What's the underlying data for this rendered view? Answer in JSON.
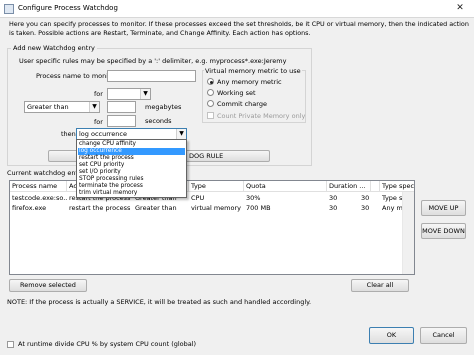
{
  "window": {
    "title": "Configure Process Watchdog",
    "close_glyph": "✕"
  },
  "description": "Here you can specify processes to monitor. If these processes exceed the set thresholds, be it CPU or virtual memory, then the indicated action is taken. Possible actions are Restart, Terminate, and Change Affinity. Each action has options.",
  "add_entry": {
    "group_title": "Add new Watchdog entry",
    "hint": "User specific rules may be specified by a ':' delimiter, e.g. myprocess*.exe:Jeremy",
    "process_label": "Process name to monitor",
    "process_value": "",
    "for_label_1": "for",
    "for_label_2": "for",
    "user_combo_value": "",
    "comparison_value": "Greater than",
    "megabytes_label": "megabytes",
    "megabytes_value": "",
    "seconds_label": "seconds",
    "seconds_value": "",
    "then_label": "then",
    "action_value": "log occurrence",
    "add_button_suffix": "DOG RULE"
  },
  "vm_type": {
    "group_title": "Virtual memory metric to use",
    "options": [
      {
        "label": "Any memory metric",
        "selected": true
      },
      {
        "label": "Working set",
        "selected": false
      },
      {
        "label": "Commit charge",
        "selected": false
      }
    ],
    "count_private_label": "Count Private Memory only",
    "count_private_checked": false
  },
  "action_dropdown": {
    "items": [
      "change CPU affinity",
      "log occurrence",
      "restart the process",
      "set CPU priority",
      "set I/O priority",
      "STOP processing rules",
      "terminate the process",
      "trim virtual memory"
    ],
    "selected_index": 1
  },
  "entries": {
    "title": "Current watchdog entries",
    "columns": [
      "Process name",
      "Ac",
      "",
      "Type",
      "Quota",
      "Duration ...",
      "Action sp...",
      "Type specific"
    ],
    "rows": [
      [
        "testcode.exe:so...",
        "restart the process",
        "Greater than",
        "CPU",
        "30%",
        "30",
        "30",
        "Type specific"
      ],
      [
        "firefox.exe",
        "restart the process",
        "Greater than",
        "virtual memory",
        "700 MB",
        "30",
        "30",
        "Any memory ..."
      ]
    ]
  },
  "buttons": {
    "move_up": "MOVE UP",
    "move_down": "MOVE DOWN",
    "remove_selected": "Remove selected",
    "clear_all": "Clear all",
    "ok": "OK",
    "cancel": "Cancel"
  },
  "note": "NOTE: If the process is actually a SERVICE, it will be treated as such and handled accordingly.",
  "runtime_divide": {
    "label": "At runtime divide CPU % by system CPU count (global)",
    "checked": false
  }
}
